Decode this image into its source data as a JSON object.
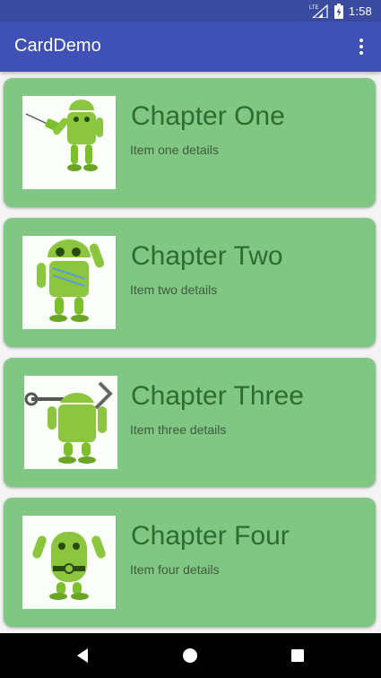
{
  "status_bar": {
    "network": "LTE",
    "time": "1:58"
  },
  "app_bar": {
    "title": "CardDemo",
    "menu_icon": "more-vert-icon"
  },
  "cards": [
    {
      "title": "Chapter One",
      "detail": "Item one details",
      "image_icon": "android-robot-drill-icon"
    },
    {
      "title": "Chapter Two",
      "detail": "Item two details",
      "image_icon": "android-robot-waving-icon"
    },
    {
      "title": "Chapter Three",
      "detail": "Item three details",
      "image_icon": "android-robot-wrench-icon"
    },
    {
      "title": "Chapter Four",
      "detail": "Item four details",
      "image_icon": "android-robot-flexing-icon"
    }
  ],
  "nav_bar": {
    "back_icon": "back-icon",
    "home_icon": "home-icon",
    "recents_icon": "recents-icon"
  },
  "colors": {
    "primary": "#3f51b5",
    "primary_dark": "#3a4ba0",
    "card": "#81c784",
    "card_text": "#2e6b31"
  }
}
